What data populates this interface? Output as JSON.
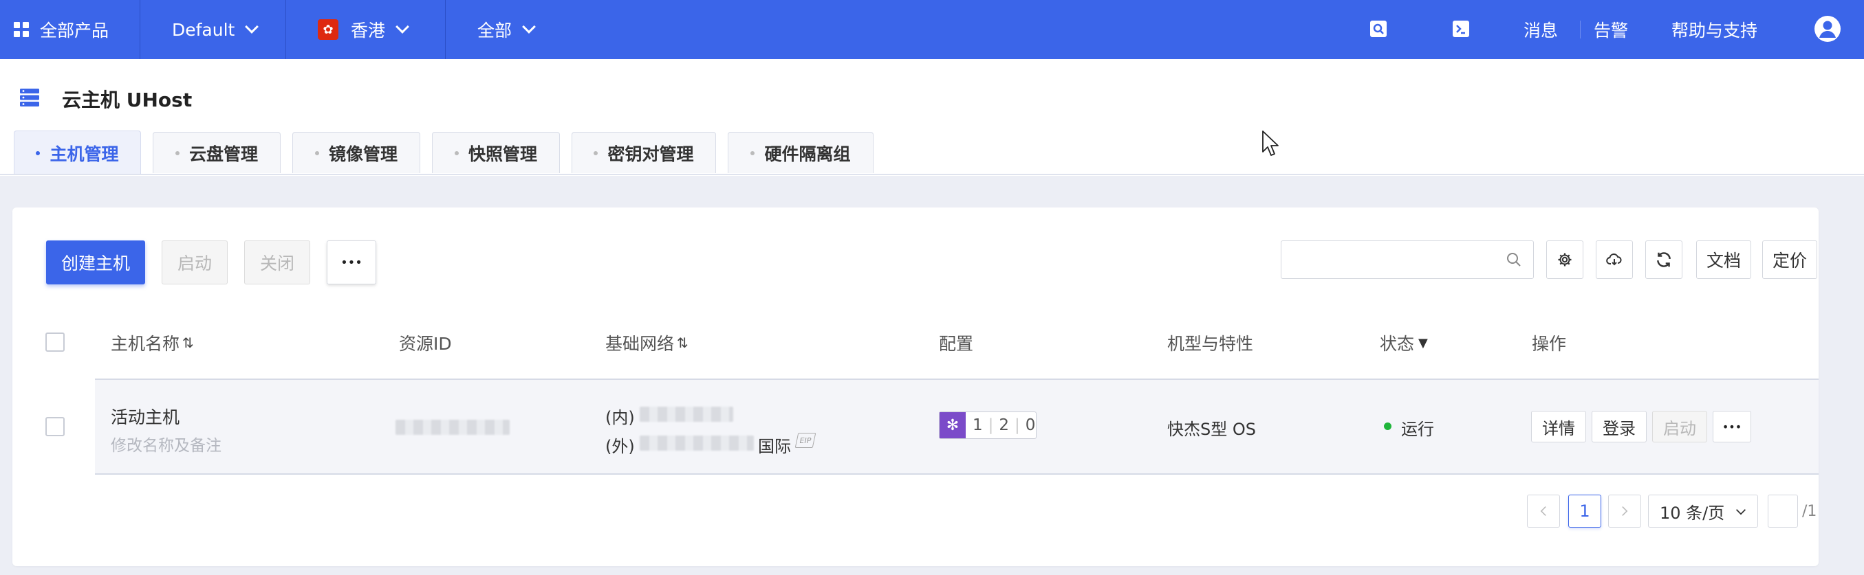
{
  "topbar": {
    "all_products": "全部产品",
    "project": "Default",
    "region_flag": "✿",
    "region": "香港",
    "zone": "全部",
    "links": {
      "messages": "消息",
      "alerts": "告警",
      "help": "帮助与支持"
    },
    "icons": [
      "search-icon",
      "terminal-icon",
      "user-avatar-icon"
    ]
  },
  "page": {
    "title": "云主机 UHost"
  },
  "tabs": [
    {
      "label": "主机管理",
      "active": true
    },
    {
      "label": "云盘管理"
    },
    {
      "label": "镜像管理"
    },
    {
      "label": "快照管理"
    },
    {
      "label": "密钥对管理"
    },
    {
      "label": "硬件隔离组"
    }
  ],
  "toolbar": {
    "create": "创建主机",
    "start": "启动",
    "stop": "关闭",
    "more": "•••",
    "search_placeholder": "",
    "docs": "文档",
    "pricing": "定价",
    "icons": [
      "settings-icon",
      "cloud-download-icon",
      "refresh-icon"
    ]
  },
  "table": {
    "columns": [
      "主机名称",
      "资源ID",
      "基础网络",
      "配置",
      "机型与特性",
      "状态",
      "操作"
    ],
    "rows": [
      {
        "name": "活动主机",
        "remark": "修改名称及备注",
        "net_in_label": "(内)",
        "net_out_label": "(外)",
        "net_out_type": "国际",
        "net_badge": "EIP",
        "config": [
          "1",
          "2",
          "0"
        ],
        "machine": "快杰S型 OS",
        "status": "运行",
        "status_color": "#1fb53b",
        "actions": {
          "detail": "详情",
          "login": "登录",
          "start": "启动",
          "more": "•••"
        }
      }
    ]
  },
  "pagination": {
    "current": "1",
    "page_size": "10 条/页",
    "total_pages": "/1"
  },
  "colors": {
    "brand": "#3b65e9",
    "config_icon": "#7b4bc9"
  }
}
